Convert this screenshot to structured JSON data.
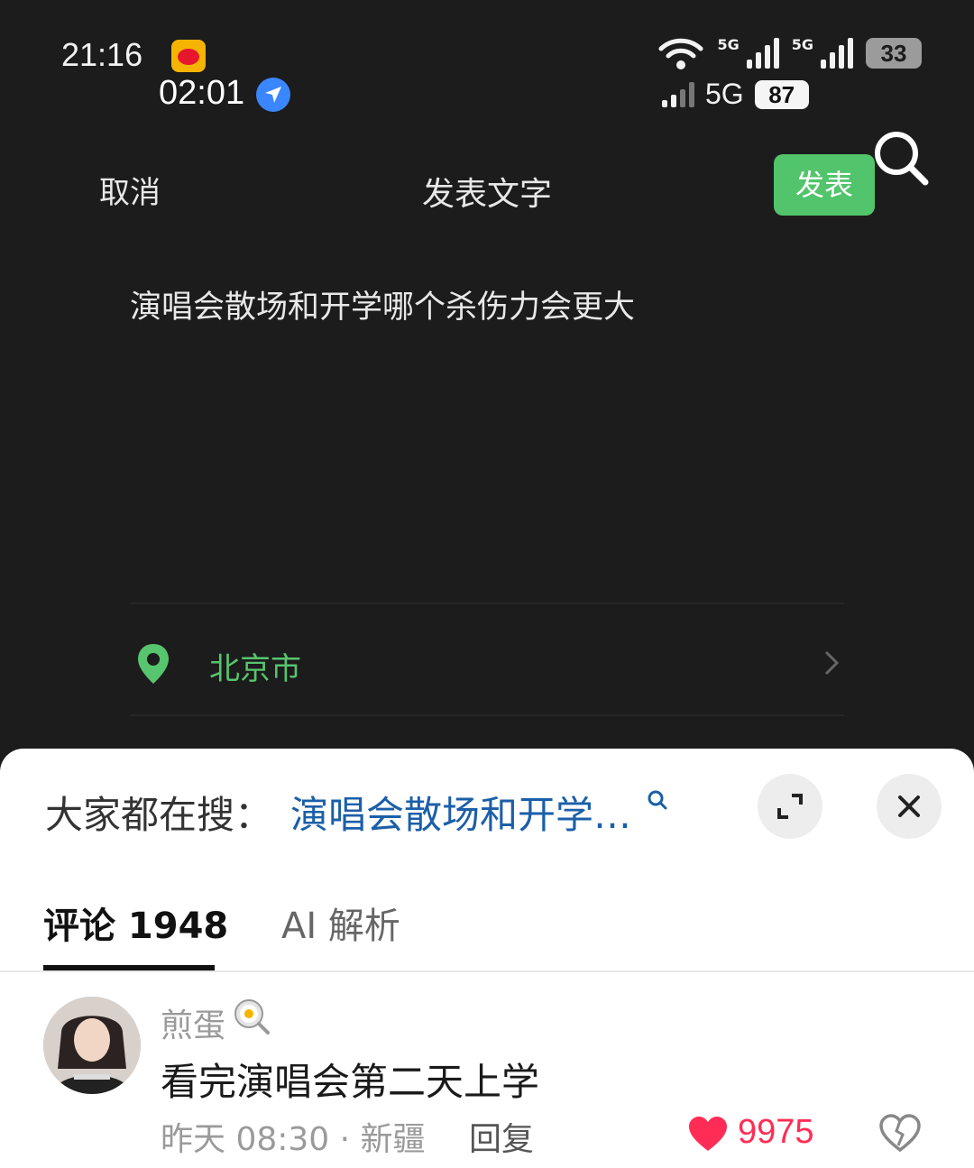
{
  "status_bar": {
    "time_primary": "21:16",
    "time_secondary": "02:01",
    "network_label_1": "5G",
    "network_label_2": "5G",
    "battery_primary": "33",
    "network_type": "5G",
    "battery_secondary": "87"
  },
  "header": {
    "cancel_label": "取消",
    "title": "发表文字",
    "publish_label": "发表"
  },
  "post": {
    "text": "演唱会散场和开学哪个杀伤力会更大"
  },
  "location": {
    "label": "北京市"
  },
  "sheet": {
    "trending_label": "大家都在搜：",
    "trending_query": "演唱会散场和开学…"
  },
  "tabs": [
    {
      "label": "评论 1948",
      "active": true
    },
    {
      "label": "AI 解析",
      "active": false
    }
  ],
  "comments": [
    {
      "username": "煎蛋",
      "text": "看完演唱会第二天上学",
      "meta": "昨天 08:30 · 新疆",
      "reply_label": "回复",
      "likes": "9975"
    }
  ],
  "colors": {
    "accent_green": "#52c46b",
    "link_blue": "#1b5fa8",
    "like_red": "#ff2d55",
    "background_dark": "#1c1c1c"
  }
}
